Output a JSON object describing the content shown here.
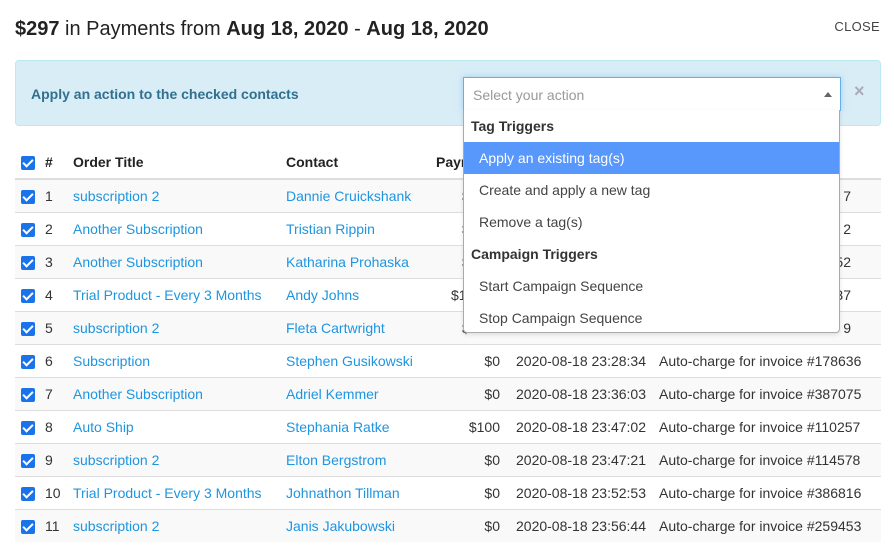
{
  "header": {
    "amount": "$297",
    "middle": " in Payments from ",
    "start": "Aug 18, 2020",
    "sep": " - ",
    "end": "Aug 18, 2020",
    "close": "CLOSE"
  },
  "action_bar": {
    "label": "Apply an action to the checked contacts",
    "placeholder": "Select your action",
    "dismiss": "×"
  },
  "dropdown": {
    "groups": [
      {
        "label": "Tag Triggers",
        "options": [
          "Apply an existing tag(s)",
          "Create and apply a new tag",
          "Remove a tag(s)"
        ]
      },
      {
        "label": "Campaign Triggers",
        "options": [
          "Start Campaign Sequence",
          "Stop Campaign Sequence"
        ]
      }
    ],
    "highlighted": "Apply an existing tag(s)"
  },
  "table": {
    "headers": [
      "#",
      "Order Title",
      "Contact",
      "Paym"
    ],
    "rows": [
      {
        "n": "1",
        "title": "subscription 2",
        "contact": "Dannie Cruickshank",
        "pay": "$",
        "date": "",
        "desc": "7"
      },
      {
        "n": "2",
        "title": "Another Subscription",
        "contact": "Tristian Rippin",
        "pay": "$",
        "date": "",
        "desc": "2"
      },
      {
        "n": "3",
        "title": "Another Subscription",
        "contact": "Katharina Prohaska",
        "pay": "$",
        "date": "",
        "desc": "52"
      },
      {
        "n": "4",
        "title": "Trial Product - Every 3 Months",
        "contact": "Andy Johns",
        "pay": "$1",
        "date": "",
        "desc": "37"
      },
      {
        "n": "5",
        "title": "subscription 2",
        "contact": "Fleta Cartwright",
        "pay": "$",
        "date": "",
        "desc": "9"
      },
      {
        "n": "6",
        "title": "Subscription",
        "contact": "Stephen Gusikowski",
        "pay": "$0",
        "date": "2020-08-18 23:28:34",
        "desc": "Auto-charge for invoice #178636"
      },
      {
        "n": "7",
        "title": "Another Subscription",
        "contact": "Adriel Kemmer",
        "pay": "$0",
        "date": "2020-08-18 23:36:03",
        "desc": "Auto-charge for invoice #387075"
      },
      {
        "n": "8",
        "title": "Auto Ship",
        "contact": "Stephania Ratke",
        "pay": "$100",
        "date": "2020-08-18 23:47:02",
        "desc": "Auto-charge for invoice #110257"
      },
      {
        "n": "9",
        "title": "subscription 2",
        "contact": "Elton Bergstrom",
        "pay": "$0",
        "date": "2020-08-18 23:47:21",
        "desc": "Auto-charge for invoice #114578"
      },
      {
        "n": "10",
        "title": "Trial Product - Every 3 Months",
        "contact": "Johnathon Tillman",
        "pay": "$0",
        "date": "2020-08-18 23:52:53",
        "desc": "Auto-charge for invoice #386816"
      },
      {
        "n": "11",
        "title": "subscription 2",
        "contact": "Janis Jakubowski",
        "pay": "$0",
        "date": "2020-08-18 23:56:44",
        "desc": "Auto-charge for invoice #259453"
      }
    ]
  }
}
